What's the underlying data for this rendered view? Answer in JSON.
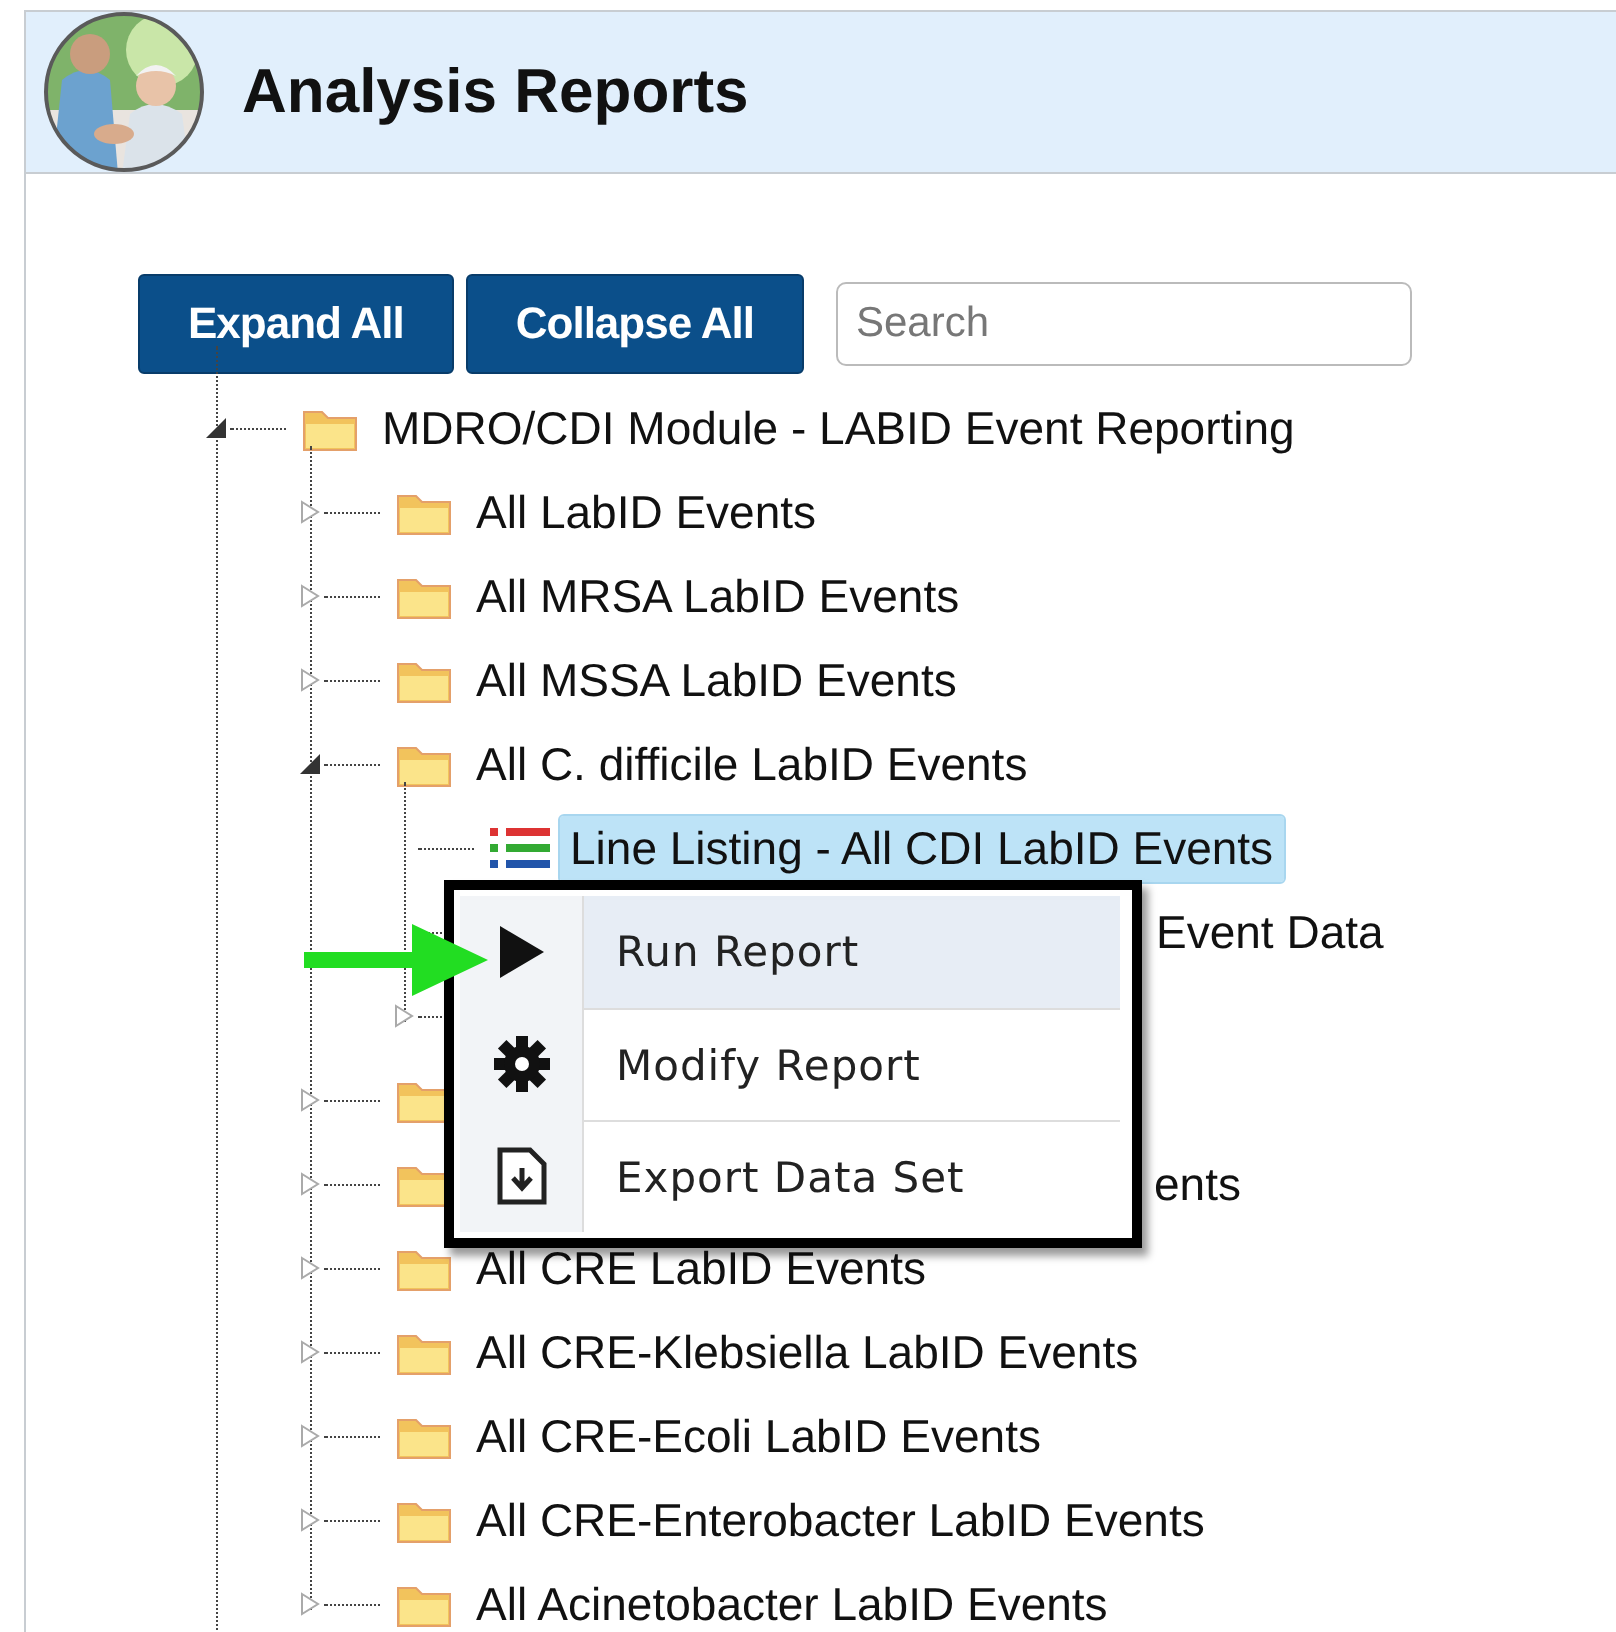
{
  "header": {
    "title": "Analysis Reports"
  },
  "toolbar": {
    "buttons": [
      {
        "label": "Expand All"
      },
      {
        "label": "Collapse All"
      }
    ],
    "search": {
      "placeholder": "Search"
    }
  },
  "tree": [
    {
      "kind": "folder",
      "label": "MDRO/CDI Module - LABID Event Reporting",
      "expanded": true,
      "children": [
        {
          "kind": "folder",
          "label": "All LabID Events",
          "expanded": false
        },
        {
          "kind": "folder",
          "label": "All MRSA LabID Events",
          "expanded": false
        },
        {
          "kind": "folder",
          "label": "All MSSA LabID Events",
          "expanded": false
        },
        {
          "kind": "folder",
          "label": "All C. difficile LabID Events",
          "expanded": true,
          "children": [
            {
              "kind": "report",
              "label": "Line Listing - All CDI LabID Events",
              "selected": true
            },
            {
              "kind": "report",
              "label": "Event Data",
              "covered": true
            },
            {
              "kind": "folder",
              "covered": true,
              "expanded": false
            }
          ]
        },
        {
          "kind": "folder",
          "covered": true,
          "expanded": false
        },
        {
          "kind": "folder",
          "label": "ents",
          "covered": true,
          "expanded": false
        },
        {
          "kind": "folder",
          "label": "All CRE LabID Events",
          "expanded": false
        },
        {
          "kind": "folder",
          "label": "All CRE-Klebsiella LabID Events",
          "expanded": false
        },
        {
          "kind": "folder",
          "label": "All CRE-Ecoli LabID Events",
          "expanded": false
        },
        {
          "kind": "folder",
          "label": "All CRE-Enterobacter LabID Events",
          "expanded": false
        },
        {
          "kind": "folder",
          "label": "All Acinetobacter LabID Events",
          "expanded": false
        }
      ]
    }
  ],
  "context_menu": {
    "items": [
      {
        "kind": "run",
        "label": "Run Report",
        "selected": true
      },
      {
        "kind": "modify",
        "label": "Modify Report",
        "selected": false
      },
      {
        "kind": "export",
        "label": "Export Data Set",
        "selected": false
      }
    ]
  }
}
